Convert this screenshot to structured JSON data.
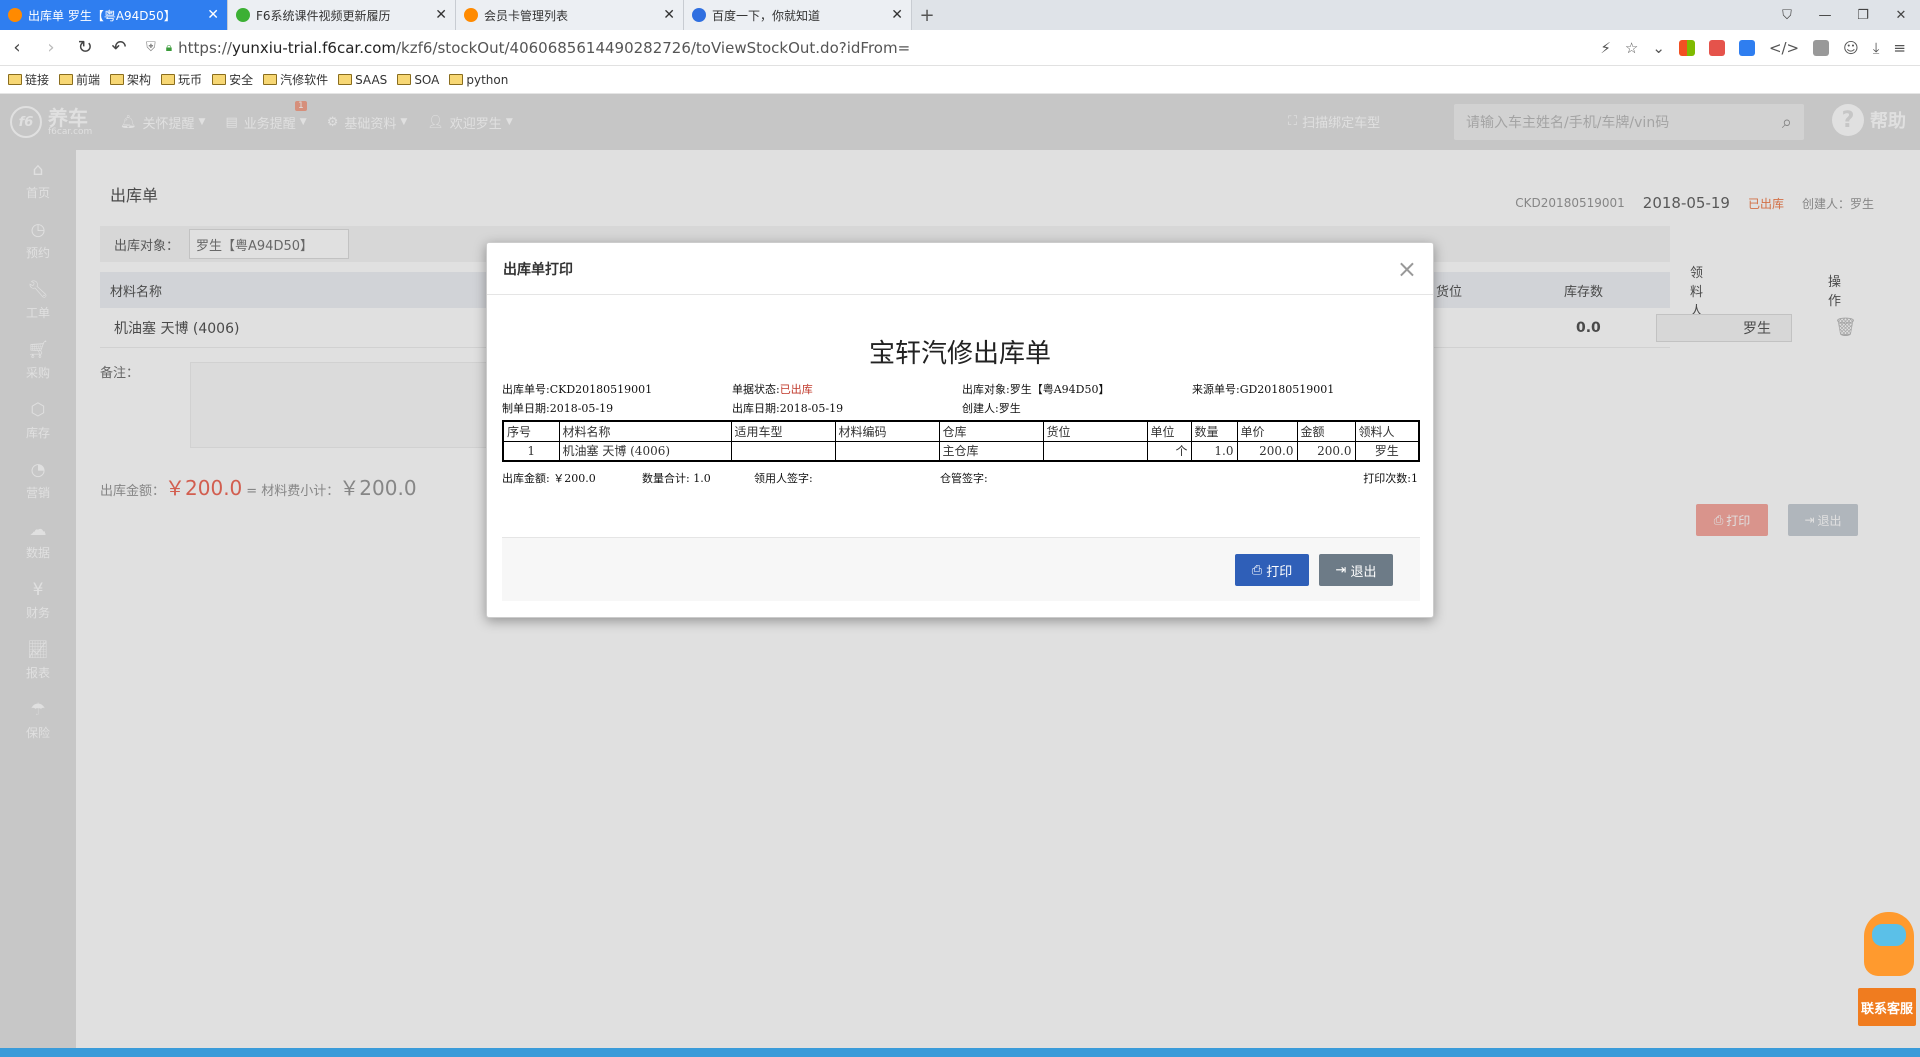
{
  "browser": {
    "tabs": [
      {
        "title": "出库单 罗生【粤A94D50】",
        "icon_color": "#ff8a00",
        "active": true
      },
      {
        "title": "F6系统课件视频更新履历",
        "icon_color": "#3cb034",
        "active": false
      },
      {
        "title": "会员卡管理列表",
        "icon_color": "#ff8a00",
        "active": false
      },
      {
        "title": "百度一下，你就知道",
        "icon_color": "#2f6fe0",
        "active": false
      }
    ],
    "url_prefix": "https://",
    "url_host": "yunxiu-trial.f6car.com",
    "url_path": "/kzf6/stockOut/406068561449028272​6/toViewStockOut.do?idFrom=",
    "bookmarks": [
      "链接",
      "前端",
      "架构",
      "玩币",
      "安全",
      "汽修软件",
      "SAAS",
      "SOA",
      "python"
    ]
  },
  "header": {
    "logo_text": "养车",
    "logo_sub": "f6car.com",
    "logo_mark": "f6",
    "nav": [
      {
        "label": "关怀提醒",
        "icon": "bell-icon"
      },
      {
        "label": "业务提醒",
        "icon": "clipboard-icon",
        "badge": "1"
      },
      {
        "label": "基础资料",
        "icon": "gear-icon"
      },
      {
        "label": "欢迎罗生",
        "icon": "user-icon"
      }
    ],
    "scan_label": "扫描绑定车型",
    "search_placeholder": "请输入车主姓名/手机/车牌/vin码",
    "help_label": "帮助"
  },
  "sidebar": {
    "items": [
      {
        "label": "首页",
        "icon": "home-icon"
      },
      {
        "label": "预约",
        "icon": "clock-icon"
      },
      {
        "label": "工单",
        "icon": "wrench-icon"
      },
      {
        "label": "采购",
        "icon": "cart-icon"
      },
      {
        "label": "库存",
        "icon": "box-icon"
      },
      {
        "label": "营销",
        "icon": "pie-icon"
      },
      {
        "label": "数据",
        "icon": "cloud-icon"
      },
      {
        "label": "财务",
        "icon": "yen-icon"
      },
      {
        "label": "报表",
        "icon": "chart-icon"
      },
      {
        "label": "保险",
        "icon": "umbrella-icon"
      }
    ]
  },
  "page": {
    "title": "出库单",
    "doc_no": "CKD20180519001",
    "date": "2018-05-19",
    "status": "已出库",
    "creator": "创建人：罗生",
    "target_label": "出库对象：",
    "target_value": "罗生【粤A94D50】",
    "table_headers": {
      "name": "材料名称",
      "location": "货位",
      "stock": "库存数",
      "receiver": "领料人",
      "action": "操作"
    },
    "row": {
      "name": "机油塞 天博 (4006)",
      "stock": "0.0",
      "receiver": "罗生"
    },
    "remark_label": "备注：",
    "amount_label": "出库金额：",
    "amount_value": "￥200.0",
    "subtotal_label": "= 材料费小计：",
    "subtotal_value": "￥200.0",
    "print_btn": "打印",
    "exit_btn": "退出"
  },
  "modal": {
    "title": "出库单打印",
    "doc_title": "宝轩汽修出库单",
    "info": {
      "doc_no": "出库单号:CKD20180519001",
      "status_label": "单据状态:",
      "status_value": "已出库",
      "target": "出库对象:罗生【粤A94D50】",
      "source_no": "来源单号:GD20180519001",
      "make_date": "制单日期:2018-05-19",
      "out_date": "出库日期:2018-05-19",
      "creator": "创建人:罗生"
    },
    "table": {
      "headers": [
        "序号",
        "材料名称",
        "适用车型",
        "材料编码",
        "仓库",
        "货位",
        "单位",
        "数量",
        "单价",
        "金额",
        "领料人"
      ],
      "rows": [
        [
          "1",
          "机油塞 天博 (4006)",
          "",
          "",
          "主仓库",
          "",
          "个",
          "1.0",
          "200.0",
          "200.0",
          "罗生"
        ]
      ]
    },
    "summary": {
      "amount": "出库金额: ￥200.0",
      "qty": "数量合计: 1.0",
      "receiver_sign": "领用人签字:",
      "keeper_sign": "仓管签字:",
      "print_count": "打印次数:1"
    },
    "print_btn": "打印",
    "exit_btn": "退出"
  },
  "cs_widget": {
    "label": "联系客服"
  },
  "colors": {
    "tab_active": "#2f7ef0",
    "primary_btn": "#2f5fb8",
    "exit_btn": "#6d7b87",
    "accent": "#f06b5b"
  }
}
